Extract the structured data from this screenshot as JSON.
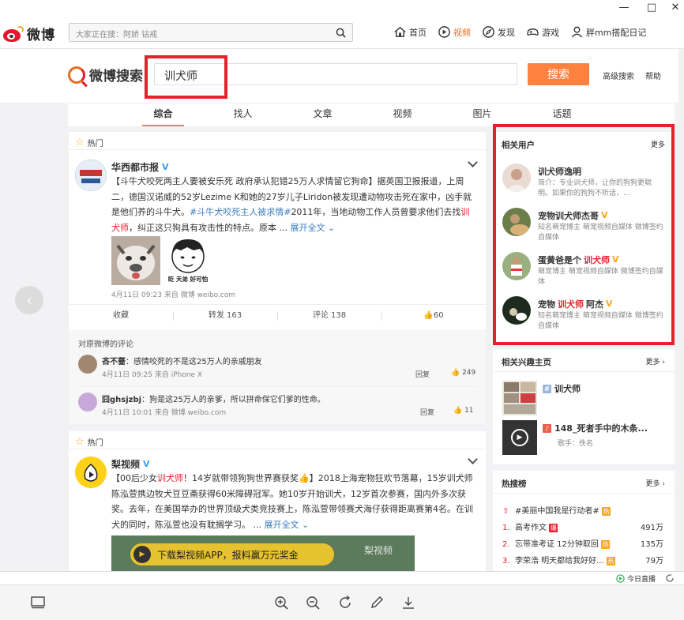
{
  "window": {
    "minimize": "—",
    "maximize": "□",
    "close": "✕"
  },
  "topnav": {
    "logo_text": "微博",
    "search_placeholder": "大家正在搜：阿娇 钻戒",
    "links": [
      {
        "label": "首页",
        "icon": "home-icon"
      },
      {
        "label": "视频",
        "icon": "video-icon"
      },
      {
        "label": "发现",
        "icon": "compass-icon"
      },
      {
        "label": "游戏",
        "icon": "gamepad-icon"
      },
      {
        "label": "胖mm搭配日记",
        "icon": "user-icon"
      }
    ]
  },
  "search": {
    "logo_text": "微博搜索",
    "query": "训犬师",
    "button": "搜索",
    "advanced": "高级搜索",
    "help": "帮助"
  },
  "tabs": [
    "综合",
    "找人",
    "文章",
    "视频",
    "图片",
    "话题"
  ],
  "posts": [
    {
      "hot_label": "热门",
      "author": "华西都市报",
      "text_1": "【斗牛犬咬死两主人要被安乐死 政府承认犯错25万人求情留它狗命】据英国卫报报道，上周二，德国汉诺威的52岁Lezime K和她的27岁儿子Liridon被发现遭动物攻击死在家中，凶手就是他们养的斗牛犬。",
      "tag": "#斗牛犬咬死主人被求情#",
      "text_2": "2011年，当地动物工作人员曾要求他们去找",
      "highlight": "训犬师",
      "text_3": "，纠正这只狗具有攻击性的特点。原本 ... ",
      "expand": "展开全文",
      "sticker_caption": "眨 天弟 好可怕",
      "meta": "4月11日 09:23 来自 微博 weibo.com",
      "actions": {
        "fav": "收藏",
        "repost": "转发 163",
        "comment": "评论 138",
        "like": "60"
      },
      "comments_title": "对原微博的评论",
      "comments": [
        {
          "user": "吝不蔷",
          "text": "：感情咬死的不是这25万人的亲戚朋友",
          "meta": "4月11日 09:25 来自 iPhone X",
          "reply": "回复",
          "likes": "249"
        },
        {
          "user": "囧ghsjzbj",
          "text": "：狗是这25万人的亲爹，所以拼命保它们爹的性命。",
          "meta": "4月11日 10:01 来自 微博 weibo.com",
          "reply": "回复",
          "likes": "11"
        }
      ]
    },
    {
      "hot_label": "热门",
      "author": "梨视频",
      "text_1": "【00后少女",
      "highlight": "训犬师",
      "text_2": "！14岁就带领狗狗世界赛获奖👍】2018上海宠物狂欢节落幕，15岁训犬师陈泓萱携边牧犬豆豆斋获得60米障碍冠军。她10岁开始训犬，12岁首次参赛，国内外多次获奖。去年，在美国举办的世界顶级犬类竞技赛上，陈泓萱带领赛犬海仔获得距离赛第4名。在训犬的同时，陈泓萱也没有耽搁学习。 ... ",
      "expand": "展开全文",
      "banner": "下载梨视频APP，报料赢万元奖金",
      "watermark": "梨视频"
    }
  ],
  "sidebar": {
    "related_users": {
      "title": "相关用户",
      "more": "更多",
      "users": [
        {
          "pre": "",
          "hl": "训犬师逸明",
          "post": "",
          "badge": "",
          "desc": "简介：专业训犬师，让你的狗狗更聪明。如果你的狗狗不听话，..."
        },
        {
          "pre": "宠物训犬师杰哥",
          "hl": "",
          "post": "",
          "badge": "V",
          "desc": "知名萌宠博主 萌宠视频自媒体 微博签约自媒体"
        },
        {
          "pre": "蛋黄爸是个",
          "hl": "训犬师",
          "post": "",
          "badge": "V",
          "desc": "萌宠博主 萌宠视频自媒体 微博签约自媒体"
        },
        {
          "pre": "宠物",
          "hl": "训犬师",
          "post": "阿杰",
          "badge": "V",
          "desc": "知名萌宠博主 萌宠视频自媒体 微博签约自媒体"
        }
      ]
    },
    "interest": {
      "title": "相关兴趣主页",
      "more": "更多",
      "items": [
        {
          "name": "训犬师",
          "sub": ""
        },
        {
          "name": "148_死者手中的木条...",
          "sub": "歌手：佚名"
        }
      ]
    },
    "hot_search": {
      "title": "热搜榜",
      "more": "更多",
      "items": [
        {
          "rank": "",
          "text": "#美丽中国我是行动者#",
          "badge": "热",
          "count": ""
        },
        {
          "rank": "1.",
          "text": "高考作文",
          "badge": "爆",
          "count": "491万"
        },
        {
          "rank": "2.",
          "text": "忘带准考证 12分钟取回",
          "badge": "热",
          "count": "135万"
        },
        {
          "rank": "3.",
          "text": "李荣浩 明天都给我好好...",
          "badge": "热",
          "count": "79万"
        }
      ]
    }
  },
  "status": {
    "live": "今日直播"
  },
  "colors": {
    "accent": "#ff8140",
    "highlight": "#e8202c",
    "link": "#3a7ebf"
  }
}
